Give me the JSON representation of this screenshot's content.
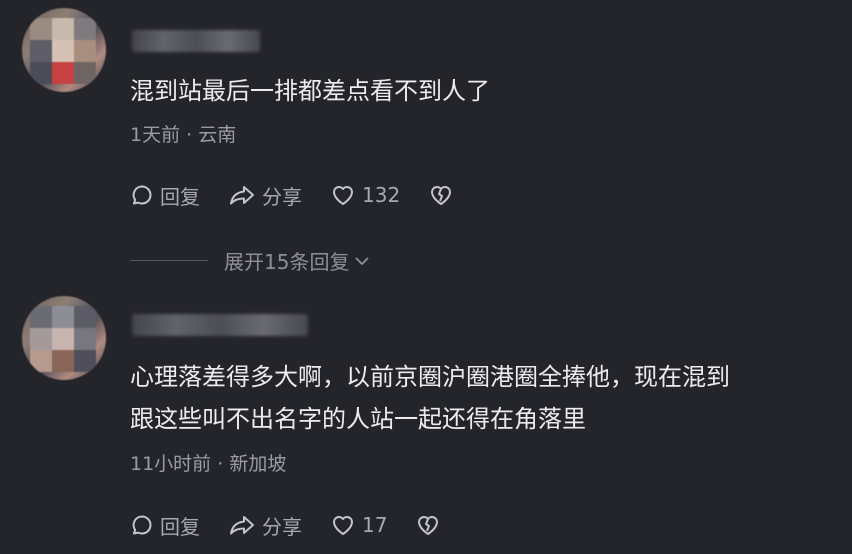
{
  "comments": [
    {
      "text_lines": [
        "混到站最后一排都差点看不到人了"
      ],
      "time": "1天前",
      "location": "云南",
      "reply_label": "回复",
      "share_label": "分享",
      "like_count": "132",
      "expand_label": "展开15条回复"
    },
    {
      "text_lines": [
        "心理落差得多大啊，以前京圈沪圈港圈全捧他，现在混到",
        "跟这些叫不出名字的人站一起还得在角落里"
      ],
      "time": "11小时前",
      "location": "新加坡",
      "reply_label": "回复",
      "share_label": "分享",
      "like_count": "17"
    }
  ],
  "icons": {
    "reply": "comment-bubble-icon",
    "share": "share-arrow-icon",
    "like": "heart-outline-icon",
    "dislike": "broken-heart-icon",
    "expand": "chevron-down-icon"
  },
  "colors": {
    "background": "#24252b",
    "text": "#ececf0",
    "meta": "#9a9ba3"
  }
}
